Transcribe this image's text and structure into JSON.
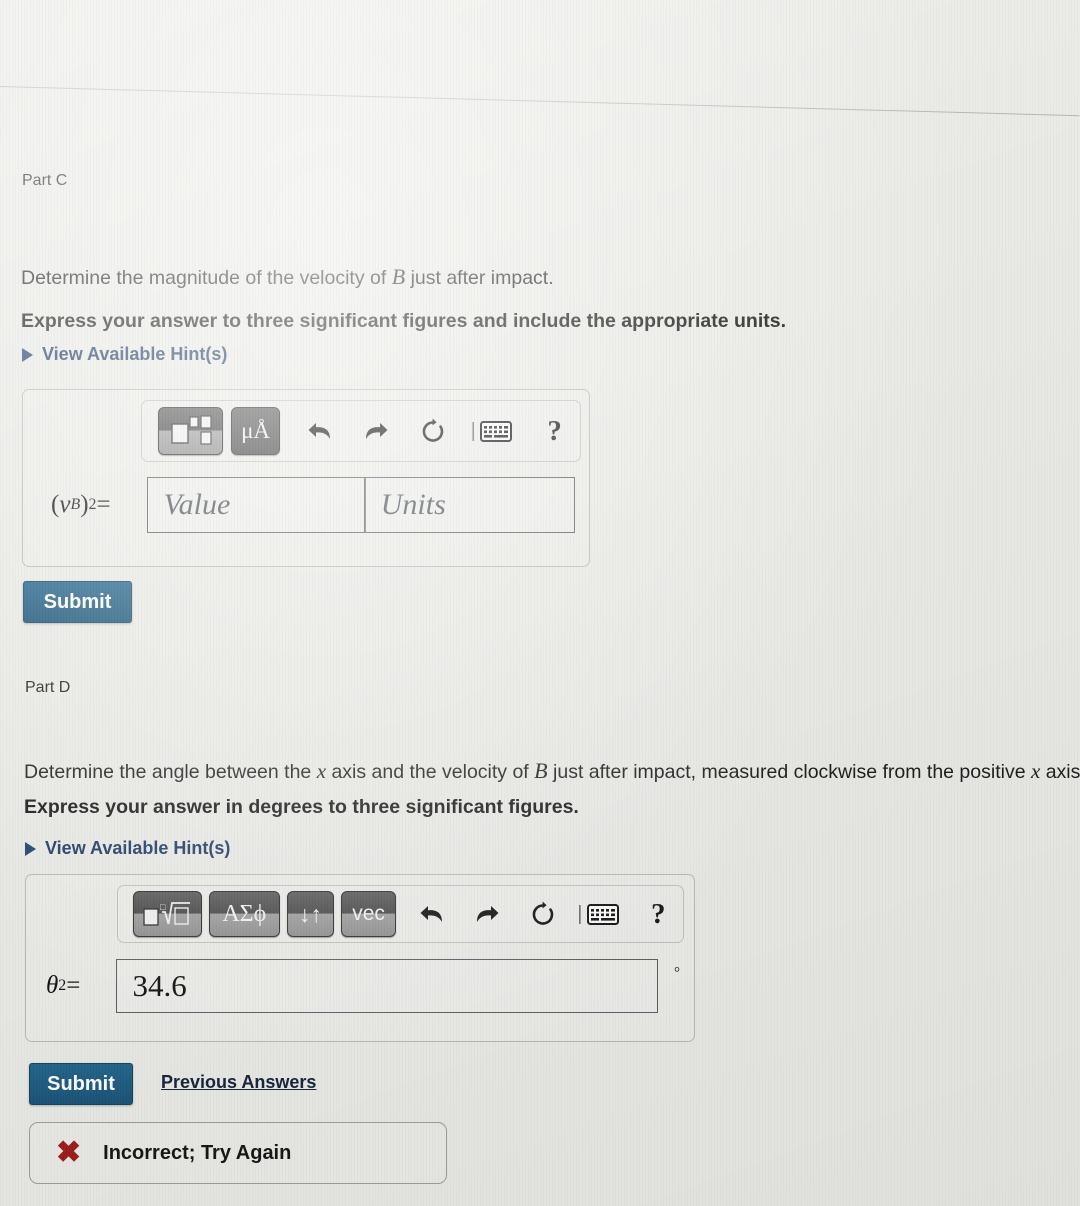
{
  "parts": [
    {
      "heading": "Part C",
      "question_prefix": "Determine the magnitude of the velocity of ",
      "question_var": "B",
      "question_suffix": " just after impact.",
      "instruction": "Express your answer to three significant figures and include the appropriate units.",
      "hints_label": "View Available Hint(s)",
      "toolbar": {
        "template_button": "template-icon",
        "units_button": "μÅ",
        "undo": "undo-icon",
        "redo": "redo-icon",
        "reset": "reset-icon",
        "keyboard": "keyboard-icon",
        "help": "?"
      },
      "answer": {
        "label_open": "(",
        "label_var": "v",
        "label_varsub": "B",
        "label_close": ")",
        "label_sub": "2",
        "label_eq": " =",
        "value_placeholder": "Value",
        "units_placeholder": "Units",
        "value": ""
      },
      "submit_label": "Submit"
    },
    {
      "heading": "Part D",
      "question_prefix": "Determine the angle between the ",
      "question_var": "x",
      "question_mid": " axis and the velocity of ",
      "question_var2": "B",
      "question_mid2": " just after impact, measured clockwise from the positive ",
      "question_var3": "x",
      "question_suffix": " axis.",
      "instruction": "Express your answer in degrees to three significant figures.",
      "hints_label": "View Available Hint(s)",
      "toolbar": {
        "template_button": "root-template-icon",
        "greek_button": "ΑΣϕ",
        "arrows_button": "↓↑",
        "vec_button": "vec",
        "undo": "undo-icon",
        "redo": "redo-icon",
        "reset": "reset-icon",
        "keyboard": "keyboard-icon",
        "help": "?"
      },
      "answer": {
        "label_var": "θ",
        "label_sub": "2",
        "label_eq": " =",
        "value": "34.6",
        "unit_symbol": "°"
      },
      "submit_label": "Submit",
      "previous_answers_label": "Previous Answers",
      "feedback": {
        "icon": "x-mark-icon",
        "text": "Incorrect; Try Again",
        "color": "#9e1b1b"
      }
    }
  ],
  "theme": {
    "page_background": "#e9e9e5",
    "submit_blue": "#1b5f86",
    "link_navy": "#1f3a63",
    "error_red": "#9e1b1b"
  }
}
